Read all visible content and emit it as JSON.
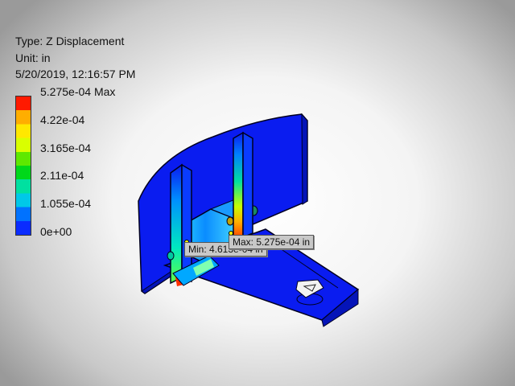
{
  "result_info": {
    "type": "Type: Z Displacement",
    "unit": "Unit: in",
    "timestamp": "5/20/2019, 12:16:57 PM"
  },
  "legend": {
    "labels": [
      "5.275e-04 Max",
      "4.22e-04",
      "3.165e-04",
      "2.11e-04",
      "1.055e-04",
      "0e+00"
    ],
    "colors": [
      "#ff1a00",
      "#ffae00",
      "#ffe800",
      "#d9ff00",
      "#5ee800",
      "#00d81a",
      "#00e0a0",
      "#00c8e8",
      "#0072ff",
      "#0a2cff"
    ]
  },
  "probes": {
    "min_label": "Min: 4.613e-04 in",
    "max_label": "Max: 5.275e-04 in"
  },
  "colors": {
    "part_body": "#0a1cf0",
    "part_edge": "#000020",
    "probe_bg": "#c8c8c8"
  }
}
